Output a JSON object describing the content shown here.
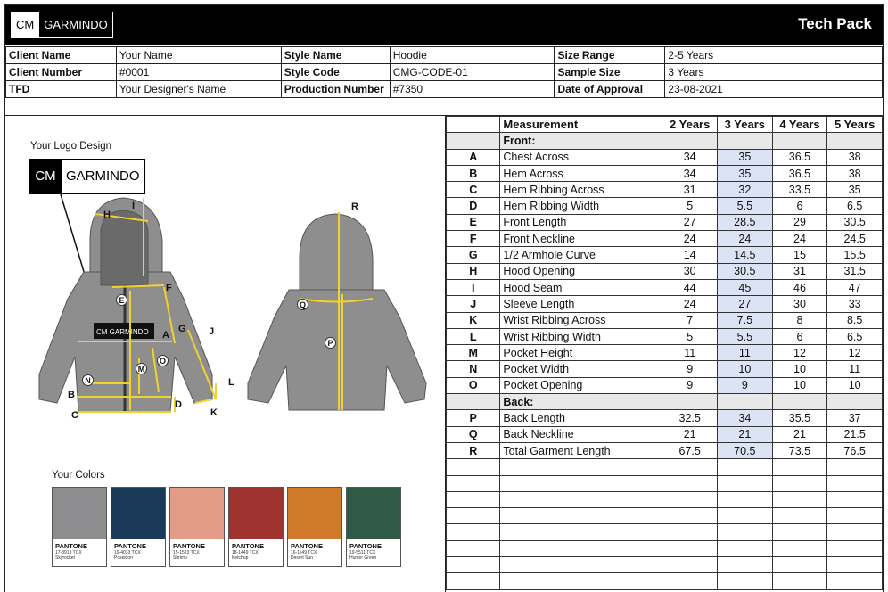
{
  "header": {
    "logo_cm": "CM",
    "logo_name": "GARMINDO",
    "title": "Tech Pack"
  },
  "info": [
    [
      "Client Name",
      "Your Name",
      "Style Name",
      "Hoodie",
      "Size Range",
      "2-5 Years"
    ],
    [
      "Client Number",
      "#0001",
      "Style Code",
      "CMG-CODE-01",
      "Sample Size",
      "3 Years"
    ],
    [
      "TFD",
      "Your Designer's Name",
      "Production Number",
      "#7350",
      "Date of Approval",
      "23-08-2021"
    ]
  ],
  "left": {
    "logo_label": "Your Logo Design",
    "logo_cm": "CM",
    "logo_name": "GARMINDO",
    "colors_label": "Your Colors",
    "hoodie_tag": "CM GARMINDO",
    "points": [
      "A",
      "B",
      "C",
      "D",
      "E",
      "F",
      "G",
      "H",
      "I",
      "J",
      "K",
      "L",
      "M",
      "N",
      "O",
      "P",
      "Q",
      "R"
    ]
  },
  "colors": [
    {
      "hex": "#8d8d8f",
      "brand": "PANTONE",
      "code": "17-3913 TCX",
      "name": "Skyrocket"
    },
    {
      "hex": "#1b3a5a",
      "brand": "PANTONE",
      "code": "19-4033 TCX",
      "name": "Poseidon"
    },
    {
      "hex": "#e39c87",
      "brand": "PANTONE",
      "code": "15-1523 TCX",
      "name": "Shrimp"
    },
    {
      "hex": "#9e3330",
      "brand": "PANTONE",
      "code": "18-1449 TCX",
      "name": "Ketchup"
    },
    {
      "hex": "#cf7b2a",
      "brand": "PANTONE",
      "code": "16-1149 TCX",
      "name": "Desert Sun"
    },
    {
      "hex": "#2e5a47",
      "brand": "PANTONE",
      "code": "19-5511 TCX",
      "name": "Hunter Green"
    }
  ],
  "measurements": {
    "headers": [
      "Measurement",
      "2 Years",
      "3 Years",
      "4 Years",
      "5 Years"
    ],
    "front_label": "Front:",
    "back_label": "Back:",
    "front": [
      [
        "A",
        "Chest Across",
        "34",
        "35",
        "36.5",
        "38"
      ],
      [
        "B",
        "Hem Across",
        "34",
        "35",
        "36.5",
        "38"
      ],
      [
        "C",
        "Hem Ribbing Across",
        "31",
        "32",
        "33.5",
        "35"
      ],
      [
        "D",
        "Hem Ribbing Width",
        "5",
        "5.5",
        "6",
        "6.5"
      ],
      [
        "E",
        "Front Length",
        "27",
        "28.5",
        "29",
        "30.5"
      ],
      [
        "F",
        "Front Neckline",
        "24",
        "24",
        "24",
        "24.5"
      ],
      [
        "G",
        "1/2 Armhole Curve",
        "14",
        "14.5",
        "15",
        "15.5"
      ],
      [
        "H",
        "Hood Opening",
        "30",
        "30.5",
        "31",
        "31.5"
      ],
      [
        "I",
        "Hood Seam",
        "44",
        "45",
        "46",
        "47"
      ],
      [
        "J",
        "Sleeve Length",
        "24",
        "27",
        "30",
        "33"
      ],
      [
        "K",
        "Wrist Ribbing Across",
        "7",
        "7.5",
        "8",
        "8.5"
      ],
      [
        "L",
        "Wrist Ribbing Width",
        "5",
        "5.5",
        "6",
        "6.5"
      ],
      [
        "M",
        "Pocket Height",
        "11",
        "11",
        "12",
        "12"
      ],
      [
        "N",
        "Pocket Width",
        "9",
        "10",
        "10",
        "11"
      ],
      [
        "O",
        "Pocket Opening",
        "9",
        "9",
        "10",
        "10"
      ]
    ],
    "back": [
      [
        "P",
        "Back Length",
        "32.5",
        "34",
        "35.5",
        "37"
      ],
      [
        "Q",
        "Back Neckline",
        "21",
        "21",
        "21",
        "21.5"
      ],
      [
        "R",
        "Total Garment Length",
        "67.5",
        "70.5",
        "73.5",
        "76.5"
      ]
    ],
    "empty_rows": 8
  }
}
